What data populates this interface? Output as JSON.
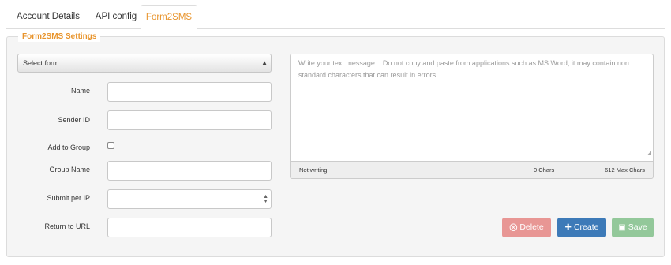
{
  "tabs": {
    "account": "Account Details",
    "api": "API config",
    "form2sms": "Form2SMS"
  },
  "panel": {
    "legend": "Form2SMS Settings"
  },
  "form": {
    "select_value": "Select form...",
    "name_label": "Name",
    "sender_label": "Sender ID",
    "group_label": "Add to Group",
    "group_name_label": "Group Name",
    "submit_label": "Submit per IP",
    "url_label": "Return to URL"
  },
  "message": {
    "placeholder": "Write your text message... Do not copy and paste from applications such as MS Word, it may contain non standard characters that can result in errors...",
    "status": "Not writing",
    "chars": "0 Chars",
    "max": "612 Max Chars"
  },
  "buttons": {
    "delete": "Delete",
    "create": "Create",
    "save": "Save"
  },
  "icons": {
    "delete": "times-circle-icon",
    "create": "plus-icon",
    "save": "floppy-disk-icon"
  },
  "colors": {
    "accent": "#e8942c",
    "delete": "#e89694",
    "create": "#3d7ab8",
    "save": "#93c89a"
  }
}
